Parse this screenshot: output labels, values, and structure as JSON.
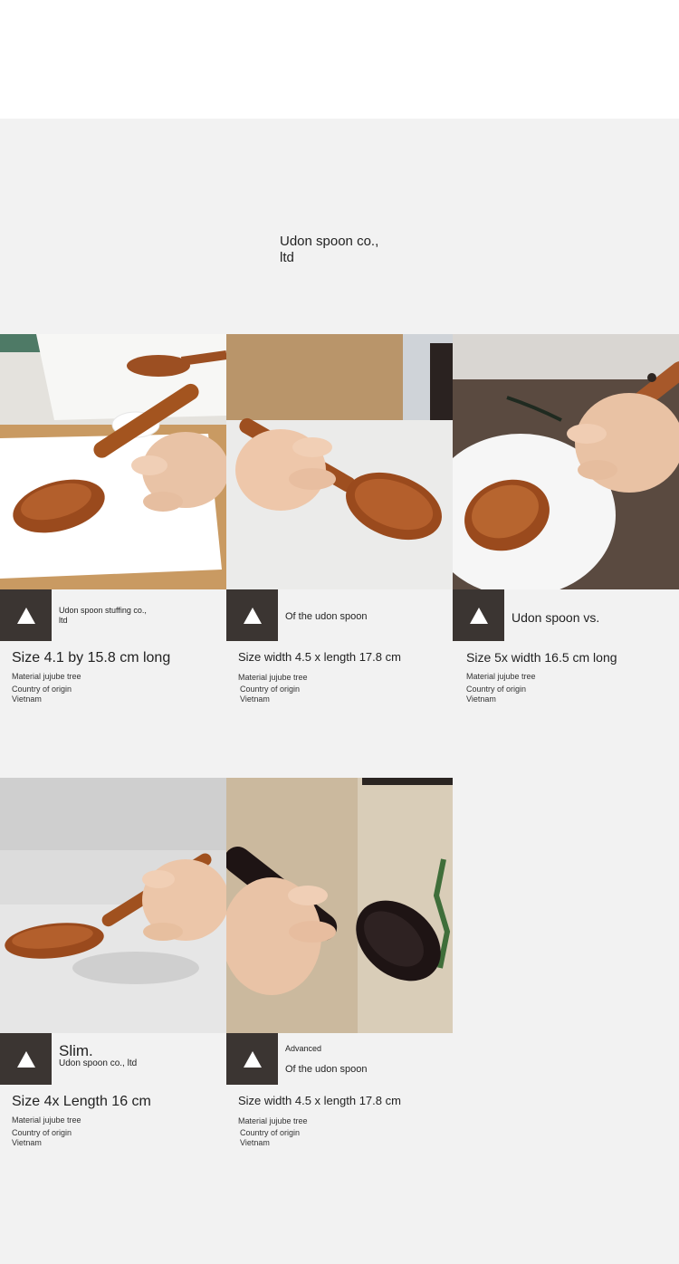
{
  "header": {
    "title_line1": "Udon spoon co.,",
    "title_line2": "ltd"
  },
  "products": [
    {
      "name": "Udon spoon stuffing co., ltd",
      "size": "Size 4.1 by 15.8 cm long",
      "material": "Material jujube tree",
      "origin_line1": "Country of origin",
      "origin_line2": "Vietnam"
    },
    {
      "name": "Of the udon spoon",
      "size": "Size width 4.5 x length 17.8 cm",
      "material": "Material jujube tree",
      "origin_line1": "Country of origin",
      "origin_line2": "Vietnam"
    },
    {
      "name": "Udon spoon vs.",
      "size": "Size 5x width 16.5 cm long",
      "material": "Material jujube tree",
      "origin_line1": "Country of origin",
      "origin_line2": "Vietnam"
    },
    {
      "name_big": "Slim.",
      "name": "Udon spoon co., ltd",
      "size": "Size 4x Length 16 cm",
      "material": "Material jujube tree",
      "origin_line1": "Country of origin",
      "origin_line2": "Vietnam"
    },
    {
      "name_small": "Advanced",
      "name": "Of the udon spoon",
      "size": "Size width 4.5 x length 17.8 cm",
      "material": "Material jujube tree",
      "origin_line1": "Country of origin",
      "origin_line2": "Vietnam"
    }
  ],
  "colors": {
    "badge": "#3b3532",
    "wood": "#a0532a",
    "dark_wood": "#1e1414"
  }
}
